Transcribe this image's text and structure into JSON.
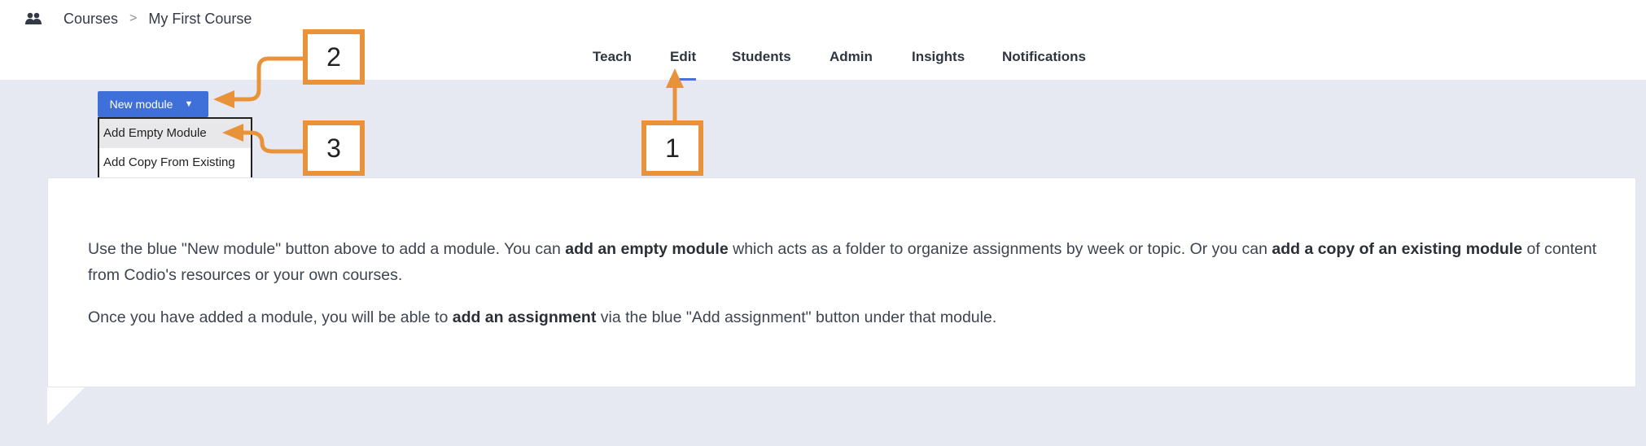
{
  "breadcrumb": {
    "icon": "people-icon",
    "items": [
      "Courses",
      "My First Course"
    ],
    "separator": ">"
  },
  "tabs": [
    {
      "label": "Teach",
      "active": false
    },
    {
      "label": "Edit",
      "active": true
    },
    {
      "label": "Students",
      "active": false
    },
    {
      "label": "Admin",
      "active": false
    },
    {
      "label": "Insights",
      "active": false
    },
    {
      "label": "Notifications",
      "active": false
    }
  ],
  "new_module": {
    "label": "New module",
    "caret": "▼",
    "menu": [
      "Add Empty Module",
      "Add Copy From Existing"
    ]
  },
  "content": {
    "p1_a": "Use the blue \"New module\" button above to add a module. You can ",
    "p1_b": "add an empty module",
    "p1_c": " which acts as a folder to organize assignments by week or topic. Or you can ",
    "p1_d": "add a copy of an existing module",
    "p1_e": " of content from Codio's resources or your own courses.",
    "p2_a": "Once you have added a module, you will be able to ",
    "p2_b": "add an assignment",
    "p2_c": " via the blue \"Add assignment\" button under that module."
  },
  "callouts": [
    "1",
    "2",
    "3"
  ],
  "colors": {
    "accent": "#3f6fd8",
    "callout": "#e8923a",
    "background": "#e6e9f2"
  }
}
